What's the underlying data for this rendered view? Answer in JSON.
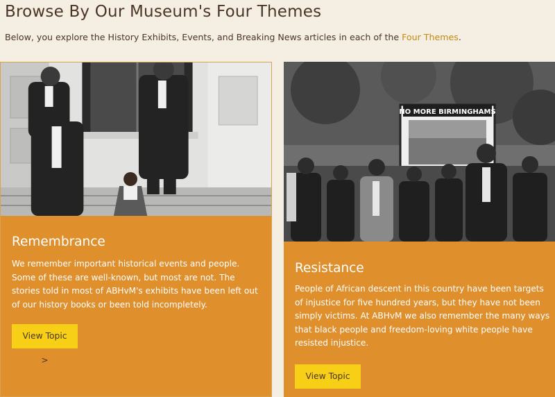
{
  "section": {
    "title": "Browse By Our Museum's Four Themes",
    "intro_text": "Below, you explore the History Exhibits, Events, and Breaking News articles in each of the ",
    "intro_link": "Four Themes",
    "intro_end": "."
  },
  "cards": [
    {
      "title": "Remembrance",
      "text": "We remember important historical events and people. Some of these are well-known, but most are not. The stories told in most of ABHvM's exhibits have been left out of our history books or been told incompletely.",
      "button_label": "View Topic >"
    },
    {
      "title": "Resistance",
      "photo_sign": "NO MORE BIRMINGHAMS",
      "text": "People of African descent in this country have been targets of injustice for five hundred years, but they have not been simply victims. At ABHvM we also remember the many ways that black people and freedom-loving white people have resisted injustice.",
      "button_label": "View Topic >"
    }
  ],
  "colors": {
    "background": "#f4efe2",
    "card": "#e08f2d",
    "button": "#f7cf16",
    "link": "#c28a16"
  }
}
